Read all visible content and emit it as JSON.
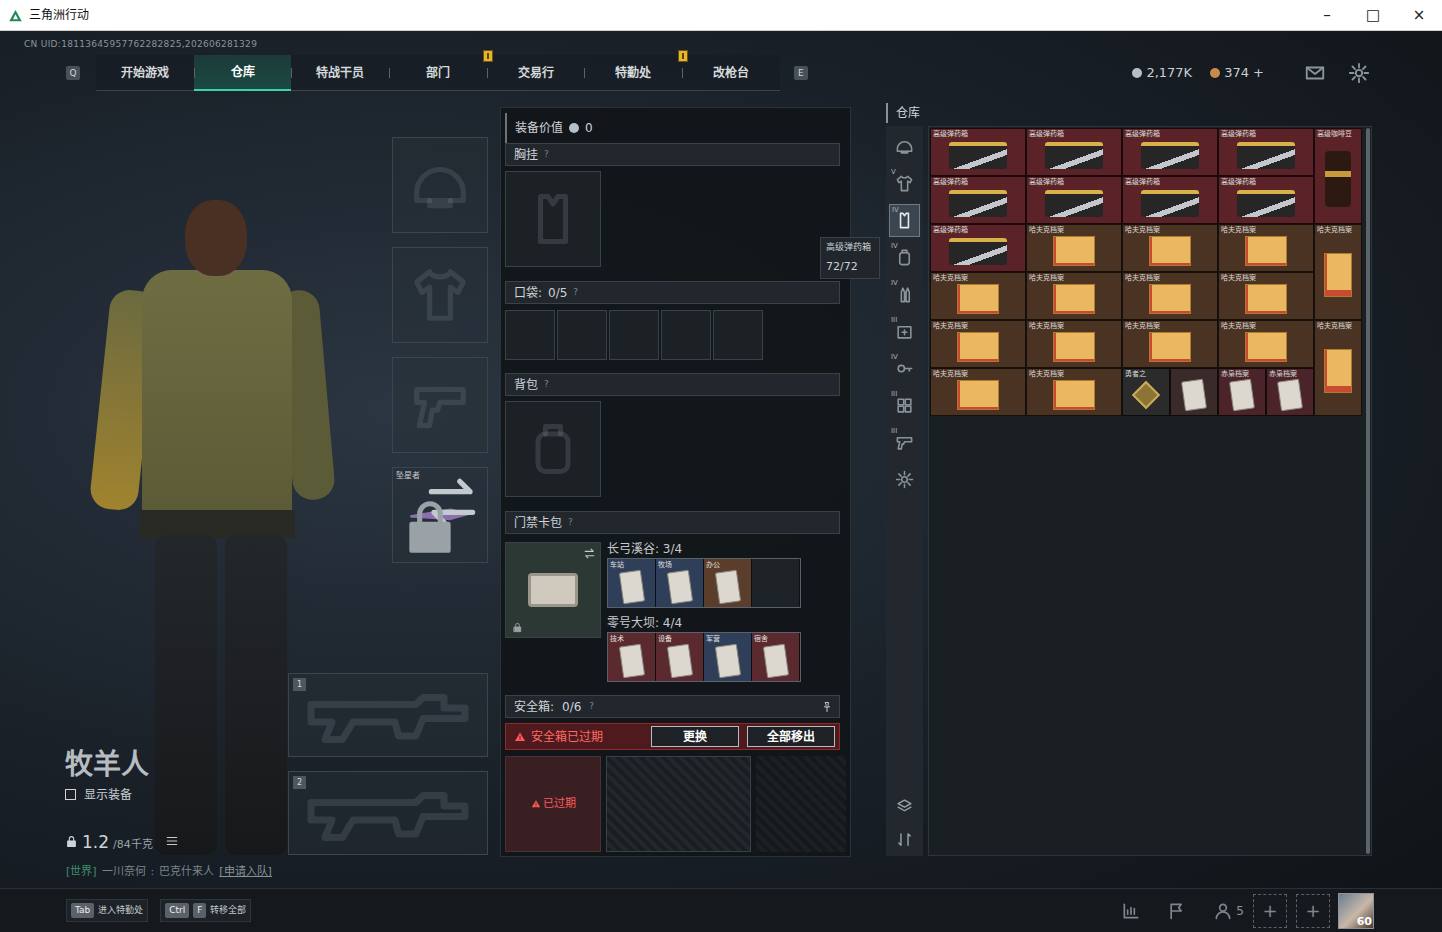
{
  "window": {
    "title": "三角洲行动",
    "controls": [
      "–",
      "□",
      "×"
    ]
  },
  "uid": "CN UID:18113645957762282825,202606281329",
  "nav": {
    "keys": [
      "Q",
      "E"
    ],
    "tabs": [
      {
        "label": "开始游戏",
        "selected": false,
        "alert": false
      },
      {
        "label": "仓库",
        "selected": true,
        "alert": false
      },
      {
        "label": "特战干员",
        "selected": false,
        "alert": false
      },
      {
        "label": "部门",
        "selected": false,
        "alert": true
      },
      {
        "label": "交易行",
        "selected": false,
        "alert": false
      },
      {
        "label": "特勤处",
        "selected": false,
        "alert": true
      },
      {
        "label": "改枪台",
        "selected": false,
        "alert": false
      }
    ]
  },
  "currency": [
    {
      "amount": "2,177K",
      "color": "#b8bec5"
    },
    {
      "amount": "374 +",
      "color": "#c98a4b"
    }
  ],
  "operator": {
    "name": "牧羊人",
    "show_gear": {
      "label": "显示装备",
      "checked": false
    },
    "weight": "1.2",
    "weight_max": "/84千克"
  },
  "chat": {
    "channel": "[世界]",
    "sender": "一川奈何",
    "separator": ":",
    "message": "巴克什来人",
    "action": "[申请入队]"
  },
  "gear_slots": [
    {
      "kind": "helmet",
      "label": "",
      "locked": false
    },
    {
      "kind": "armor",
      "label": "",
      "locked": false
    },
    {
      "kind": "pistol",
      "label": "",
      "locked": false
    },
    {
      "kind": "melee",
      "label": "坠星者",
      "locked": true
    }
  ],
  "weapon_slots": [
    {
      "number": "1"
    },
    {
      "number": "2"
    }
  ],
  "loadout": {
    "value_label": "装备价值",
    "value": "0",
    "chest": {
      "label": "胸挂",
      "help": "?"
    },
    "pockets": {
      "label": "口袋:",
      "count": "0/5",
      "help": "?",
      "slots": [
        {
          "filled": false
        },
        {
          "filled": false
        },
        {
          "filled": false
        },
        {
          "filled": false
        },
        {
          "filled": false
        }
      ]
    },
    "backpack": {
      "label": "背包",
      "help": "?"
    },
    "keycards": {
      "label": "门禁卡包",
      "help": "?",
      "locked": true,
      "maps": [
        {
          "name": "长弓溪谷: 3/4",
          "cards": [
            {
              "label": "车站",
              "filled": true,
              "color": "#2f3f5a"
            },
            {
              "label": "牧场",
              "filled": true,
              "color": "#2f3f5a"
            },
            {
              "label": "办公",
              "filled": true,
              "color": "#5a3d2a"
            },
            {
              "label": "",
              "filled": false,
              "color": "#1e2328"
            }
          ]
        },
        {
          "name": "零号大坝: 4/4",
          "cards": [
            {
              "label": "技术",
              "filled": true,
              "color": "#5b2a2e"
            },
            {
              "label": "设备",
              "filled": true,
              "color": "#5b2a2e"
            },
            {
              "label": "军营",
              "filled": true,
              "color": "#2f3f5a"
            },
            {
              "label": "宿舍",
              "filled": true,
              "color": "#5b2a2e"
            }
          ]
        }
      ]
    },
    "safe": {
      "label": "安全箱:",
      "count": "0/6",
      "help": "?",
      "warning": "安全箱已过期",
      "buttons": [
        "更换",
        "全部移出"
      ],
      "expired": "已过期"
    }
  },
  "tooltip": {
    "title": "高级弹药箱",
    "count": "72/72"
  },
  "warehouse": {
    "title": "仓库",
    "categories": [
      {
        "kind": "helmet",
        "label": "",
        "selected": false
      },
      {
        "kind": "armor",
        "label": "V",
        "selected": false
      },
      {
        "kind": "vest",
        "label": "IV",
        "selected": true
      },
      {
        "kind": "backpack",
        "label": "IV",
        "selected": false
      },
      {
        "kind": "ammo",
        "label": "IV",
        "selected": false
      },
      {
        "kind": "med",
        "label": "III",
        "selected": false
      },
      {
        "kind": "key",
        "label": "IV",
        "selected": false
      },
      {
        "kind": "misc",
        "label": "III",
        "selected": false
      },
      {
        "kind": "pistol",
        "label": "III",
        "selected": false
      },
      {
        "kind": "gear",
        "label": "",
        "selected": false
      }
    ],
    "tools": [
      {
        "kind": "layers"
      },
      {
        "kind": "sort"
      }
    ],
    "items": [
      {
        "kind": "ammo-box",
        "label": "高级弹药箱",
        "color": "#5b2327"
      },
      {
        "kind": "ammo-box",
        "label": "高级弹药箱",
        "color": "#5b2327"
      },
      {
        "kind": "ammo-box",
        "label": "高级弹药箱",
        "color": "#5b2327"
      },
      {
        "kind": "ammo-box",
        "label": "高级弹药箱",
        "color": "#5b2327"
      },
      {
        "kind": "coffee",
        "label": "高级咖啡豆",
        "color": "#5b2327"
      },
      {
        "kind": "ammo-box",
        "label": "高级弹药箱",
        "color": "#5b2327"
      },
      {
        "kind": "ammo-box",
        "label": "高级弹药箱",
        "color": "#5b2327"
      },
      {
        "kind": "ammo-box",
        "label": "高级弹药箱",
        "color": "#5b2327"
      },
      {
        "kind": "ammo-box",
        "label": "高级弹药箱",
        "color": "#5b2327"
      },
      {
        "kind": "ammo-box",
        "label": "高级弹药箱",
        "color": "#5b2327"
      },
      {
        "kind": "archive",
        "label": "哈夫克档案",
        "color": "#4a3322"
      },
      {
        "kind": "archive",
        "label": "哈夫克档案",
        "color": "#4a3322"
      },
      {
        "kind": "archive",
        "label": "哈夫克档案",
        "color": "#4a3322"
      },
      {
        "kind": "archive-tall",
        "label": "哈夫克档案",
        "color": "#4a3322"
      },
      {
        "kind": "archive",
        "label": "哈夫克档案",
        "color": "#4a3322"
      },
      {
        "kind": "archive",
        "label": "哈夫克档案",
        "color": "#4a3322"
      },
      {
        "kind": "archive",
        "label": "哈夫克档案",
        "color": "#4a3322"
      },
      {
        "kind": "archive",
        "label": "哈夫克档案",
        "color": "#4a3322"
      },
      {
        "kind": "archive",
        "label": "哈夫克档案",
        "color": "#4a3322"
      },
      {
        "kind": "archive",
        "label": "哈夫克档案",
        "color": "#4a3322"
      },
      {
        "kind": "archive",
        "label": "哈夫克档案",
        "color": "#4a3322"
      },
      {
        "kind": "archive",
        "label": "哈夫克档案",
        "color": "#4a3322"
      },
      {
        "kind": "archive-tall",
        "label": "哈夫克档案",
        "color": "#4a3322"
      },
      {
        "kind": "archive",
        "label": "哈夫克档案",
        "color": "#4a3322"
      },
      {
        "kind": "archive",
        "label": "哈夫克档案",
        "color": "#4a3322"
      },
      {
        "kind": "badge",
        "label": "勇者之",
        "color": "#2b2b2b"
      },
      {
        "kind": "card",
        "label": "",
        "color": "#3a2a2a"
      },
      {
        "kind": "card",
        "label": "赤枭档案",
        "color": "#4a2428"
      },
      {
        "kind": "card",
        "label": "赤枭档案",
        "color": "#4a2428"
      }
    ]
  },
  "footer": {
    "hints": [
      {
        "keys": [
          "Tab"
        ],
        "label": "进入特勤处"
      },
      {
        "keys": [
          "Ctrl",
          "F"
        ],
        "label": "转移全部"
      }
    ],
    "friends": "5",
    "invite_slots": [
      "+",
      "+"
    ],
    "level": "60"
  }
}
